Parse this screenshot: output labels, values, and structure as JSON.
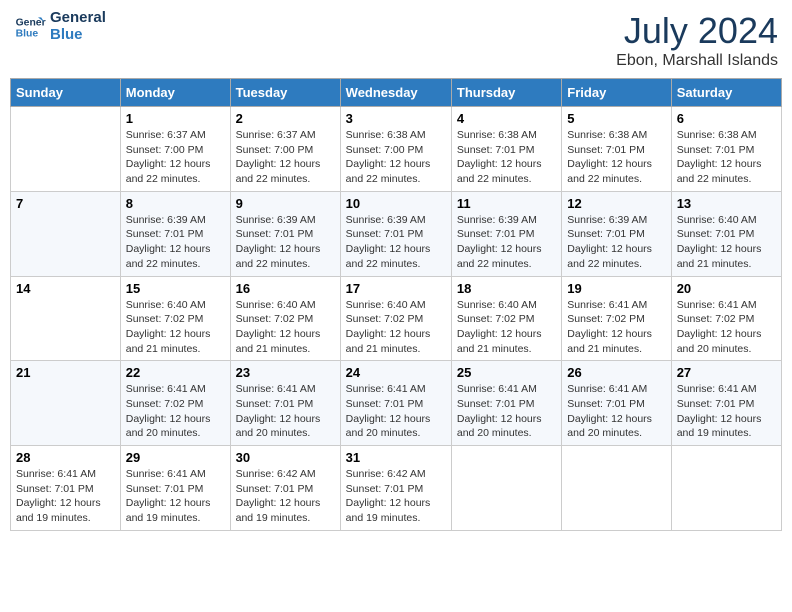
{
  "header": {
    "logo_line1": "General",
    "logo_line2": "Blue",
    "month_year": "July 2024",
    "location": "Ebon, Marshall Islands"
  },
  "days_of_week": [
    "Sunday",
    "Monday",
    "Tuesday",
    "Wednesday",
    "Thursday",
    "Friday",
    "Saturday"
  ],
  "weeks": [
    [
      {
        "day": "",
        "detail": ""
      },
      {
        "day": "1",
        "detail": "Sunrise: 6:37 AM\nSunset: 7:00 PM\nDaylight: 12 hours\nand 22 minutes."
      },
      {
        "day": "2",
        "detail": "Sunrise: 6:37 AM\nSunset: 7:00 PM\nDaylight: 12 hours\nand 22 minutes."
      },
      {
        "day": "3",
        "detail": "Sunrise: 6:38 AM\nSunset: 7:00 PM\nDaylight: 12 hours\nand 22 minutes."
      },
      {
        "day": "4",
        "detail": "Sunrise: 6:38 AM\nSunset: 7:01 PM\nDaylight: 12 hours\nand 22 minutes."
      },
      {
        "day": "5",
        "detail": "Sunrise: 6:38 AM\nSunset: 7:01 PM\nDaylight: 12 hours\nand 22 minutes."
      },
      {
        "day": "6",
        "detail": "Sunrise: 6:38 AM\nSunset: 7:01 PM\nDaylight: 12 hours\nand 22 minutes."
      }
    ],
    [
      {
        "day": "7",
        "detail": ""
      },
      {
        "day": "8",
        "detail": "Sunrise: 6:39 AM\nSunset: 7:01 PM\nDaylight: 12 hours\nand 22 minutes."
      },
      {
        "day": "9",
        "detail": "Sunrise: 6:39 AM\nSunset: 7:01 PM\nDaylight: 12 hours\nand 22 minutes."
      },
      {
        "day": "10",
        "detail": "Sunrise: 6:39 AM\nSunset: 7:01 PM\nDaylight: 12 hours\nand 22 minutes."
      },
      {
        "day": "11",
        "detail": "Sunrise: 6:39 AM\nSunset: 7:01 PM\nDaylight: 12 hours\nand 22 minutes."
      },
      {
        "day": "12",
        "detail": "Sunrise: 6:39 AM\nSunset: 7:01 PM\nDaylight: 12 hours\nand 22 minutes."
      },
      {
        "day": "13",
        "detail": "Sunrise: 6:40 AM\nSunset: 7:01 PM\nDaylight: 12 hours\nand 21 minutes."
      }
    ],
    [
      {
        "day": "14",
        "detail": ""
      },
      {
        "day": "15",
        "detail": "Sunrise: 6:40 AM\nSunset: 7:02 PM\nDaylight: 12 hours\nand 21 minutes."
      },
      {
        "day": "16",
        "detail": "Sunrise: 6:40 AM\nSunset: 7:02 PM\nDaylight: 12 hours\nand 21 minutes."
      },
      {
        "day": "17",
        "detail": "Sunrise: 6:40 AM\nSunset: 7:02 PM\nDaylight: 12 hours\nand 21 minutes."
      },
      {
        "day": "18",
        "detail": "Sunrise: 6:40 AM\nSunset: 7:02 PM\nDaylight: 12 hours\nand 21 minutes."
      },
      {
        "day": "19",
        "detail": "Sunrise: 6:41 AM\nSunset: 7:02 PM\nDaylight: 12 hours\nand 21 minutes."
      },
      {
        "day": "20",
        "detail": "Sunrise: 6:41 AM\nSunset: 7:02 PM\nDaylight: 12 hours\nand 20 minutes."
      }
    ],
    [
      {
        "day": "21",
        "detail": ""
      },
      {
        "day": "22",
        "detail": "Sunrise: 6:41 AM\nSunset: 7:02 PM\nDaylight: 12 hours\nand 20 minutes."
      },
      {
        "day": "23",
        "detail": "Sunrise: 6:41 AM\nSunset: 7:01 PM\nDaylight: 12 hours\nand 20 minutes."
      },
      {
        "day": "24",
        "detail": "Sunrise: 6:41 AM\nSunset: 7:01 PM\nDaylight: 12 hours\nand 20 minutes."
      },
      {
        "day": "25",
        "detail": "Sunrise: 6:41 AM\nSunset: 7:01 PM\nDaylight: 12 hours\nand 20 minutes."
      },
      {
        "day": "26",
        "detail": "Sunrise: 6:41 AM\nSunset: 7:01 PM\nDaylight: 12 hours\nand 20 minutes."
      },
      {
        "day": "27",
        "detail": "Sunrise: 6:41 AM\nSunset: 7:01 PM\nDaylight: 12 hours\nand 19 minutes."
      }
    ],
    [
      {
        "day": "28",
        "detail": "Sunrise: 6:41 AM\nSunset: 7:01 PM\nDaylight: 12 hours\nand 19 minutes."
      },
      {
        "day": "29",
        "detail": "Sunrise: 6:41 AM\nSunset: 7:01 PM\nDaylight: 12 hours\nand 19 minutes."
      },
      {
        "day": "30",
        "detail": "Sunrise: 6:42 AM\nSunset: 7:01 PM\nDaylight: 12 hours\nand 19 minutes."
      },
      {
        "day": "31",
        "detail": "Sunrise: 6:42 AM\nSunset: 7:01 PM\nDaylight: 12 hours\nand 19 minutes."
      },
      {
        "day": "",
        "detail": ""
      },
      {
        "day": "",
        "detail": ""
      },
      {
        "day": "",
        "detail": ""
      }
    ]
  ]
}
